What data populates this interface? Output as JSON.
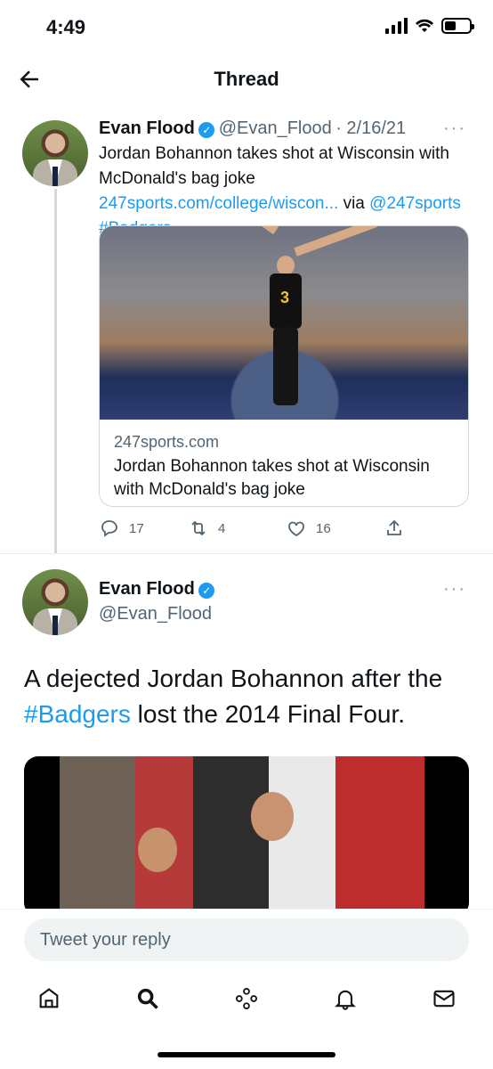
{
  "status": {
    "time": "4:49"
  },
  "header": {
    "title": "Thread"
  },
  "tweet1": {
    "name": "Evan Flood",
    "handle": "@Evan_Flood",
    "date": "· 2/16/21",
    "text_plain": "Jordan Bohannon takes shot at Wisconsin with McDonald's bag joke ",
    "link_text": "247sports.com/college/wiscon...",
    "via_text": " via ",
    "mention": "@247sports",
    "hashtag": "#Badgers",
    "card": {
      "domain": "247sports.com",
      "title": "Jordan Bohannon takes shot at Wisconsin with McDonald's bag joke",
      "player_number": "3"
    },
    "actions": {
      "replies": "17",
      "retweets": "4",
      "likes": "16"
    }
  },
  "tweet2": {
    "name": "Evan Flood",
    "handle": "@Evan_Flood",
    "text_plain_1": "A dejected Jordan Bohannon after the ",
    "hashtag": "#Badgers",
    "text_plain_2": " lost the 2014 Final Four."
  },
  "reply": {
    "placeholder": "Tweet your reply"
  },
  "colors": {
    "accent": "#1d9bf0",
    "text": "#0f1419",
    "muted": "#536471"
  },
  "icons": [
    "back-arrow-icon",
    "verified-icon",
    "more-icon",
    "reply-icon",
    "retweet-icon",
    "like-icon",
    "share-icon",
    "home-icon",
    "search-icon",
    "spaces-icon",
    "notifications-icon",
    "messages-icon"
  ]
}
